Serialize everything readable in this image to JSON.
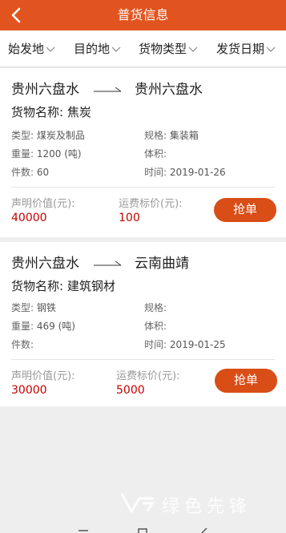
{
  "header": {
    "title": "普货信息",
    "back_icon": "back-arrow-icon"
  },
  "filters": [
    {
      "label": "始发地"
    },
    {
      "label": "目的地"
    },
    {
      "label": "货物类型"
    },
    {
      "label": "发货日期"
    }
  ],
  "labels": {
    "goods_prefix": "货物名称: ",
    "type": "类型: ",
    "spec": "规格: ",
    "weight": "重量: ",
    "volume": "体积: ",
    "count": "件数: ",
    "time": "时间: ",
    "declared": "声明价值(元):",
    "freight": "运费标价(元):",
    "grab": "抢单"
  },
  "cards": [
    {
      "from": "贵州六盘水",
      "to": "贵州六盘水",
      "goods": "焦炭",
      "type": "煤炭及制品",
      "spec": "集装箱",
      "weight": "1200 (吨)",
      "volume": "",
      "count": "60",
      "time": "2019-01-26",
      "declared_value": "40000",
      "freight_price": "100"
    },
    {
      "from": "贵州六盘水",
      "to": "云南曲靖",
      "goods": "建筑钢材",
      "type": "钢铁",
      "spec": "",
      "weight": "469 (吨)",
      "volume": "",
      "count": "",
      "time": "2019-01-25",
      "declared_value": "30000",
      "freight_price": "5000"
    }
  ],
  "watermark": {
    "text": "绿色先锋"
  },
  "colors": {
    "accent": "#e2541f",
    "price": "#c40000",
    "button": "#d94d16"
  }
}
